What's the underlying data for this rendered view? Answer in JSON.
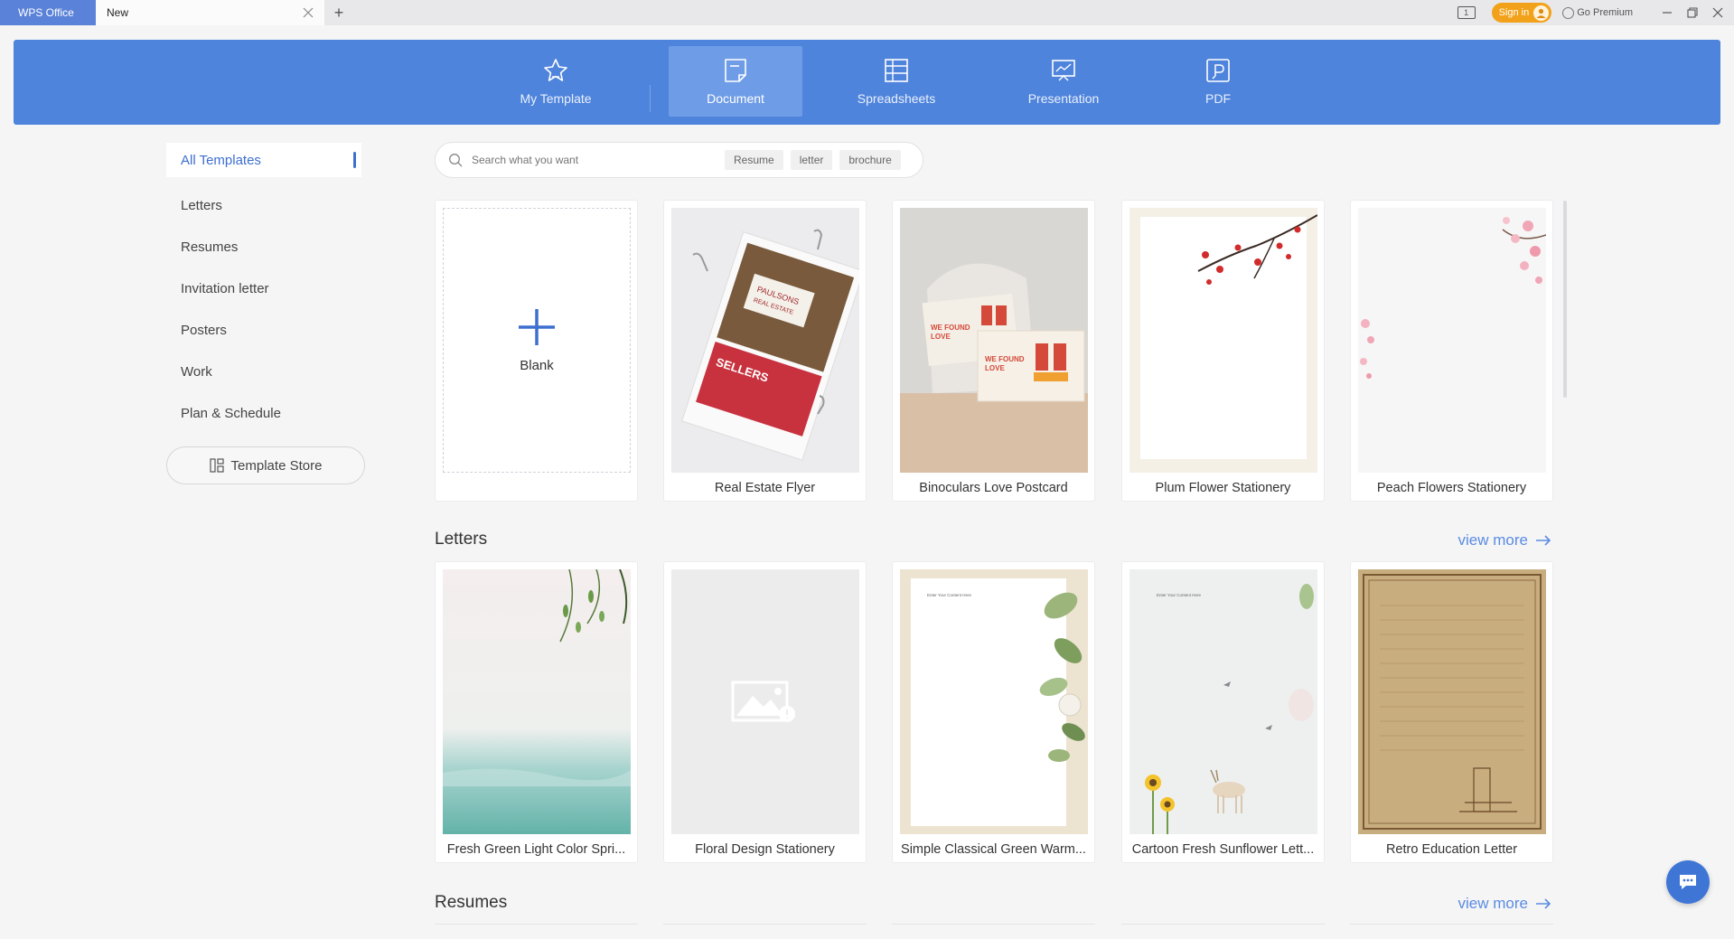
{
  "titlebar": {
    "app_tab": "WPS Office",
    "doc_tab": "New",
    "new_tab_symbol": "+",
    "signin": "Sign in",
    "premium": "Go Premium"
  },
  "header": {
    "categories": [
      {
        "label": "My Template",
        "icon": "star-icon"
      },
      {
        "label": "Document",
        "icon": "document-icon",
        "active": true
      },
      {
        "label": "Spreadsheets",
        "icon": "spreadsheet-icon"
      },
      {
        "label": "Presentation",
        "icon": "presentation-icon"
      },
      {
        "label": "PDF",
        "icon": "pdf-icon"
      }
    ]
  },
  "sidebar": {
    "items": [
      "All Templates",
      "Letters",
      "Resumes",
      "Invitation letter",
      "Posters",
      "Work",
      "Plan & Schedule"
    ],
    "store_button": "Template Store"
  },
  "search": {
    "placeholder": "Search what you want",
    "chips": [
      "Resume",
      "letter",
      "brochure"
    ]
  },
  "templates": {
    "row1": [
      "Blank",
      "Real Estate Flyer",
      "Binoculars Love Postcard",
      "Plum Flower Stationery",
      "Peach Flowers Stationery"
    ]
  },
  "letters": {
    "title": "Letters",
    "view_more": "view more",
    "items": [
      "Fresh Green Light Color Spri...",
      "Floral Design Stationery",
      "Simple Classical Green Warm...",
      "Cartoon Fresh Sunflower Lett...",
      "Retro Education Letter"
    ]
  },
  "resumes": {
    "title": "Resumes",
    "view_more": "view more"
  },
  "thumb_text": {
    "realestate_name": "PAULSONS",
    "realestate_sub": "REAL ESTATE",
    "realestate_sellers": "SELLERS",
    "postcard_line1": "WE FOUND",
    "postcard_line2": "LOVE",
    "letter_heading": "Enter Your Content Here"
  },
  "colors": {
    "accent": "#4f84dc",
    "signin": "#f2a21a",
    "link": "#5a8ce2"
  }
}
